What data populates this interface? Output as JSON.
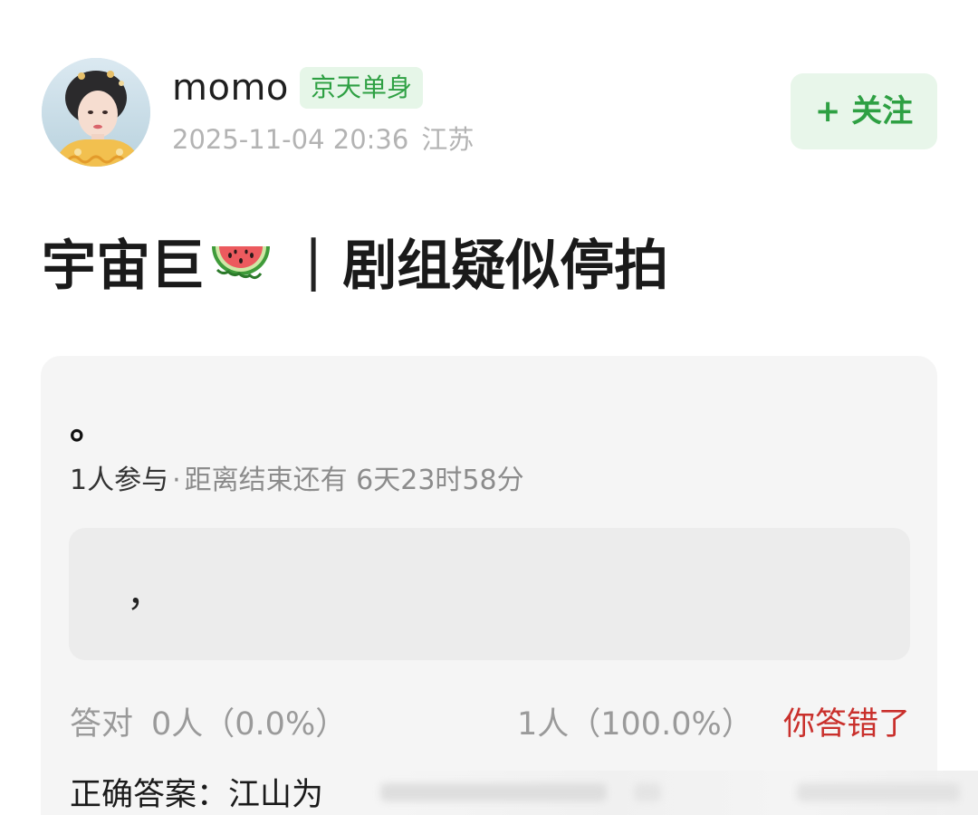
{
  "header": {
    "username": "momo",
    "tag": "京天单身",
    "timestamp": "2025-11-04 20:36",
    "location": "江苏",
    "follow_label": "+ 关注"
  },
  "post": {
    "title_prefix": "宇宙巨",
    "title_emoji": "watermelon-icon",
    "title_separator": "|",
    "title_suffix": "剧组疑似停拍"
  },
  "vote": {
    "title": "。",
    "participants": "1人参与",
    "separator": "·",
    "ends_in": "距离结束还有 6天23时58分",
    "option_text": "，",
    "correct_label": "答对",
    "correct_count": "0人（0.0%）",
    "other_count": "1人（100.0%）",
    "verdict": "你答错了",
    "answer_label": "正确答案：",
    "answer_value": "江山为"
  },
  "colors": {
    "accent_green": "#2ea043",
    "badge_bg": "#e6f6e8",
    "verdict_red": "#c9302c",
    "meta_gray": "#b3b3b3"
  }
}
